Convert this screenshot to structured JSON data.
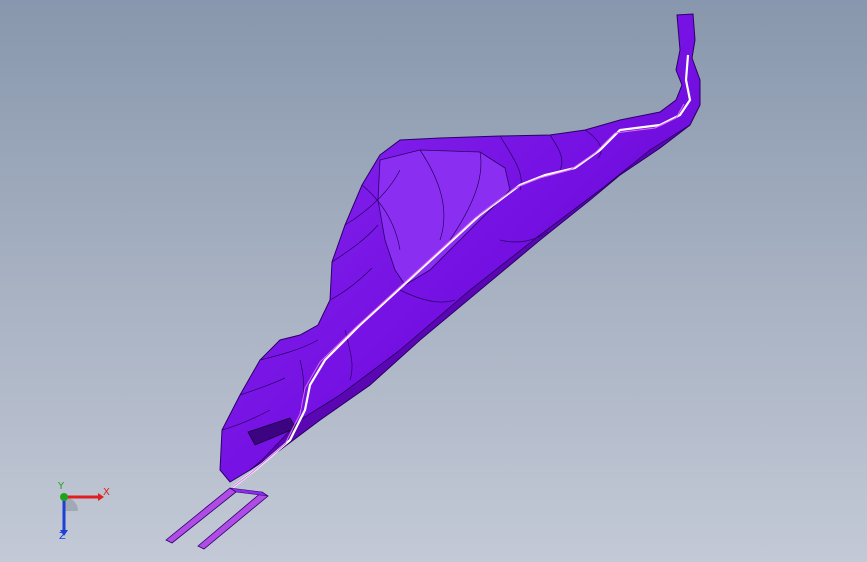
{
  "viewport": {
    "background_top": "#8897ad",
    "background_bottom": "#c3c9d6"
  },
  "model": {
    "surface_color": "#7a10e6",
    "edge_color": "#2a0066",
    "highlight_color": "#ffffff",
    "section_color": "#d86ef0"
  },
  "triad": {
    "x_label": "X",
    "y_label": "Y",
    "z_label": "Z",
    "x_color": "#e02020",
    "y_color": "#1fa31f",
    "z_color": "#1e3fd6"
  }
}
